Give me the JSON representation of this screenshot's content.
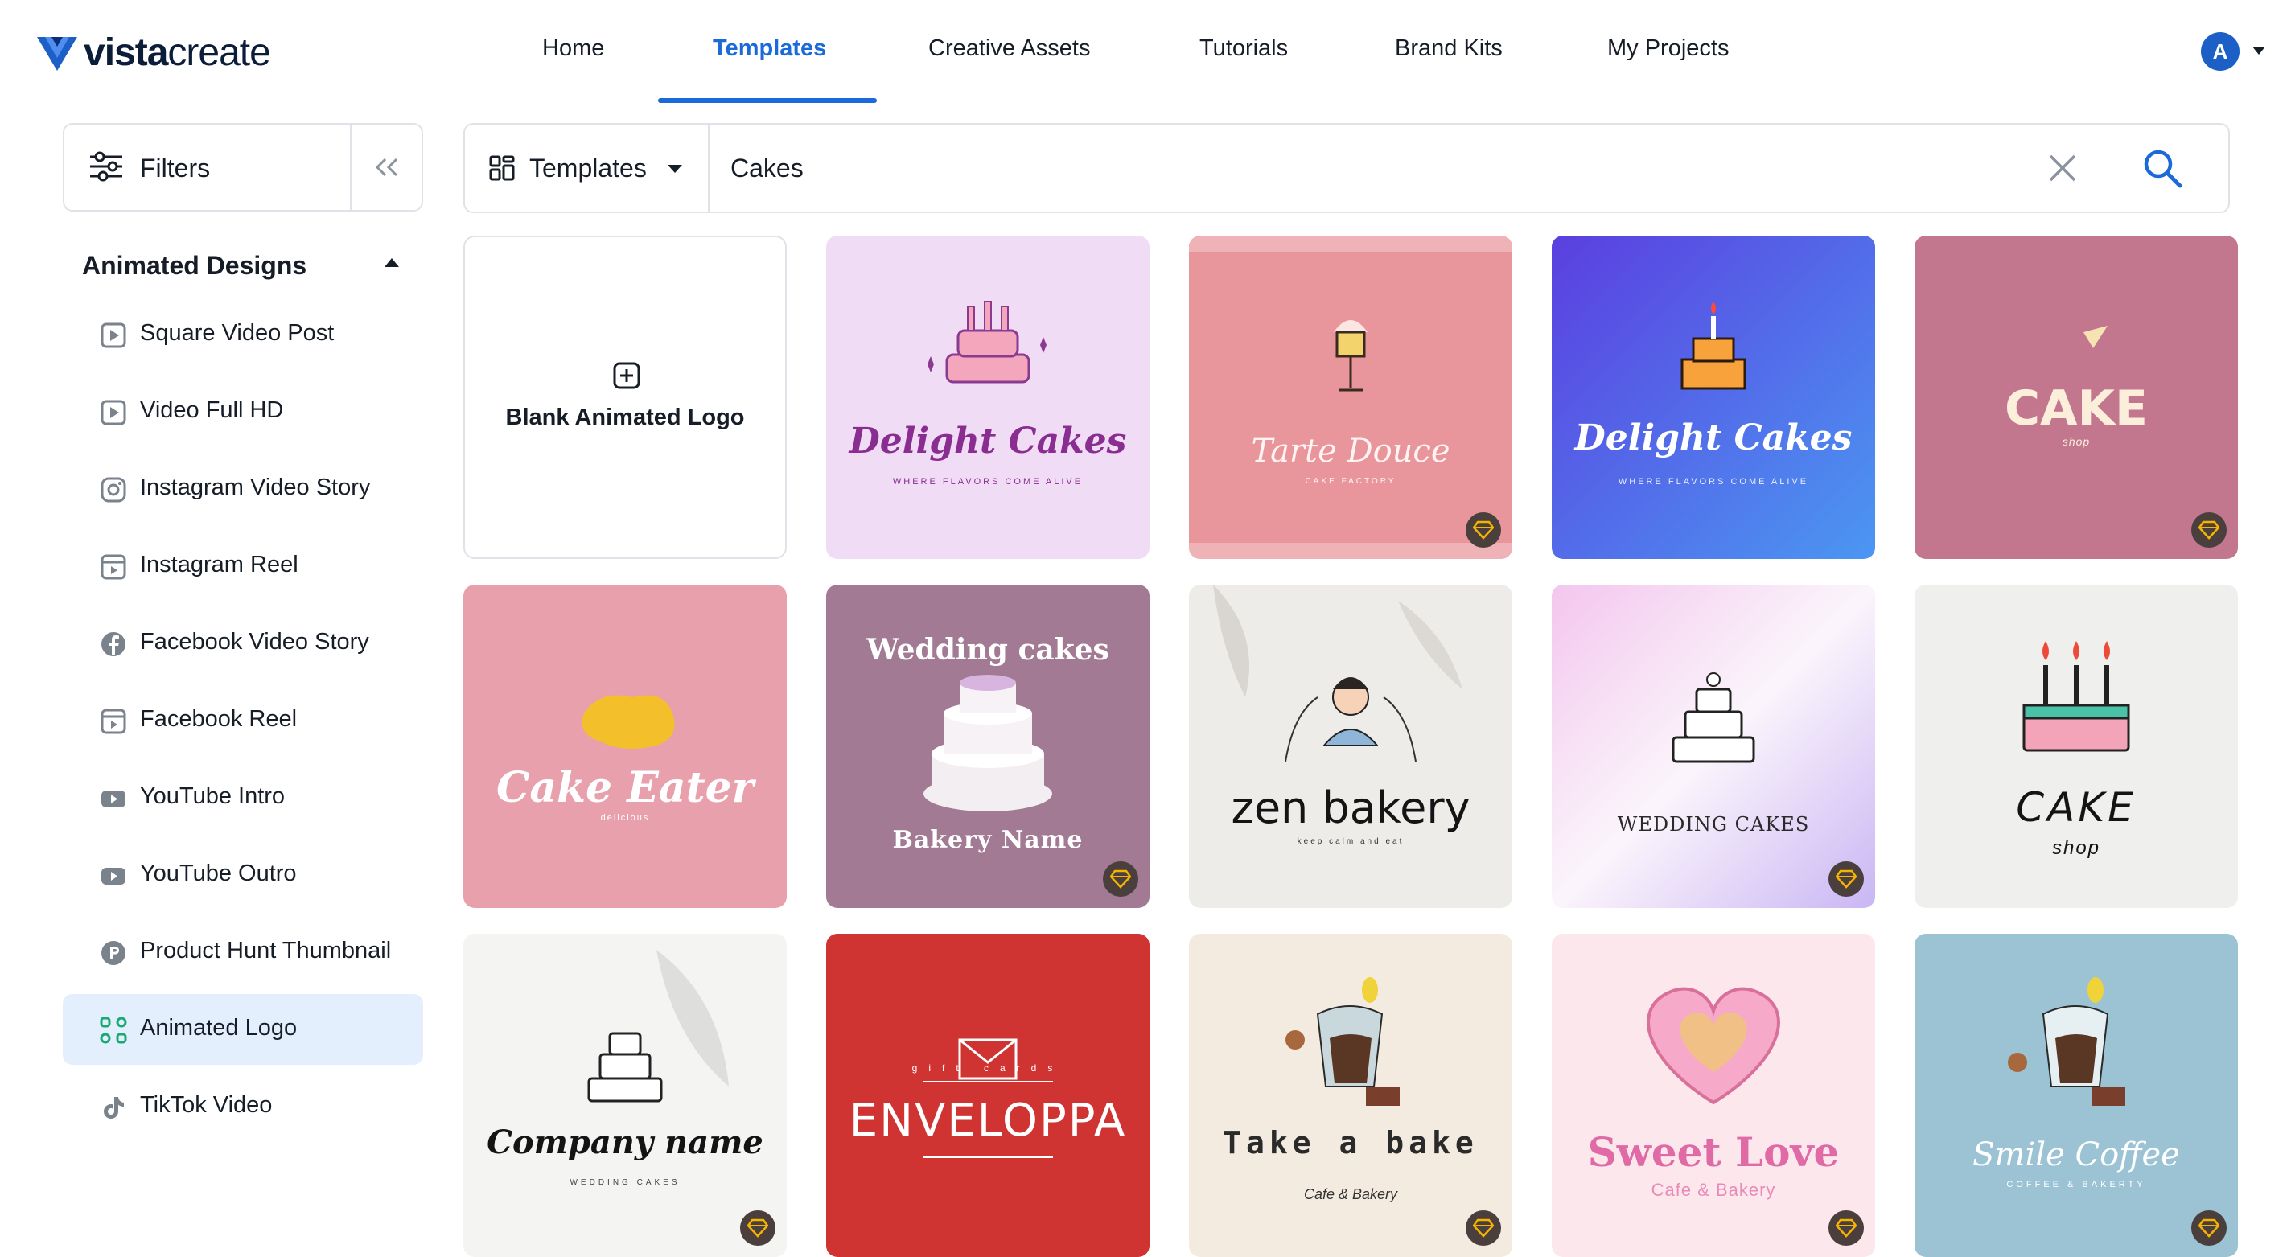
{
  "brand": {
    "name": "vistacreate",
    "name_bold": "vista",
    "name_light": "create"
  },
  "nav": {
    "items": [
      "Home",
      "Templates",
      "Creative Assets",
      "Tutorials",
      "Brand Kits",
      "My Projects"
    ],
    "active": "Templates",
    "avatar_initial": "A"
  },
  "sidebar": {
    "filters_label": "Filters",
    "section_title": "Animated Designs",
    "items": [
      {
        "label": "Square Video Post",
        "icon": "play-square-icon"
      },
      {
        "label": "Video Full HD",
        "icon": "play-square-icon"
      },
      {
        "label": "Instagram Video Story",
        "icon": "instagram-icon"
      },
      {
        "label": "Instagram Reel",
        "icon": "reel-icon"
      },
      {
        "label": "Facebook Video Story",
        "icon": "facebook-icon"
      },
      {
        "label": "Facebook Reel",
        "icon": "reel-icon"
      },
      {
        "label": "YouTube Intro",
        "icon": "youtube-icon"
      },
      {
        "label": "YouTube Outro",
        "icon": "youtube-icon"
      },
      {
        "label": "Product Hunt Thumbnail",
        "icon": "product-hunt-icon"
      },
      {
        "label": "Animated Logo",
        "icon": "animated-logo-icon",
        "active": true
      },
      {
        "label": "TikTok Video",
        "icon": "tiktok-icon"
      }
    ]
  },
  "search": {
    "type_label": "Templates",
    "query": "Cakes"
  },
  "grid": {
    "blank_label": "Blank Animated Logo",
    "cards": [
      {
        "title": "Delight Cakes",
        "subtitle": "WHERE FLAVORS COME ALIVE",
        "premium": false
      },
      {
        "title": "Tarte Douce",
        "subtitle": "CAKE FACTORY",
        "premium": true
      },
      {
        "title": "Delight Cakes",
        "subtitle": "WHERE FLAVORS COME ALIVE",
        "premium": false
      },
      {
        "title": "CAKE",
        "subtitle": "shop",
        "premium": true
      },
      {
        "title": "Cake Eater",
        "subtitle": "delicious",
        "premium": false
      },
      {
        "title": "Wedding cakes",
        "subtitle": "Bakery Name",
        "premium": true
      },
      {
        "title": "zen bakery",
        "subtitle": "keep calm and eat",
        "premium": false
      },
      {
        "title": "WEDDING CAKES",
        "subtitle": "",
        "premium": true
      },
      {
        "title": "CAKE",
        "subtitle": "shop",
        "premium": false
      },
      {
        "title": "Company name",
        "subtitle": "WEDDING CAKES",
        "premium": true
      },
      {
        "title": "ENVELOPPA",
        "subtitle": "gift cards",
        "premium": false
      },
      {
        "title": "Take a bake",
        "subtitle": "Cafe & Bakery",
        "premium": true
      },
      {
        "title": "Sweet Love",
        "subtitle": "Cafe & Bakery",
        "premium": true
      },
      {
        "title": "Smile Coffee",
        "subtitle": "COFFEE & BAKERTY",
        "premium": true
      }
    ]
  },
  "colors": {
    "accent": "#1b6ad9",
    "sidebar_active_bg": "#e3effd",
    "border": "#dfe3e8",
    "premium_badge": "#4a3f3c",
    "premium_gem": "#f4b400"
  }
}
